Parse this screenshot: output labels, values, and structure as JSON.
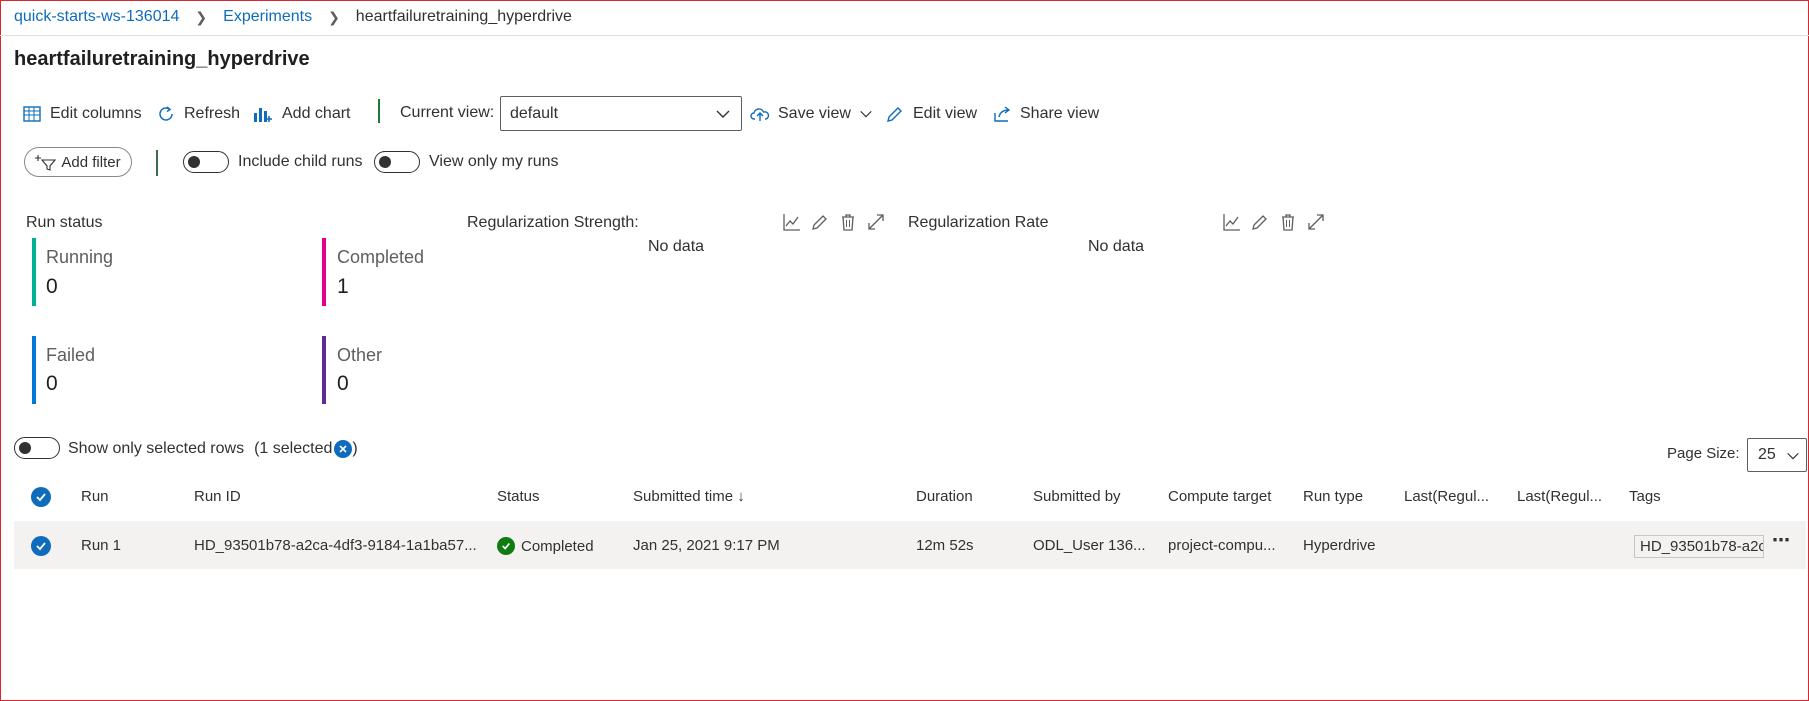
{
  "breadcrumb": {
    "workspace": "quick-starts-ws-136014",
    "experiments": "Experiments",
    "current": "heartfailuretraining_hyperdrive"
  },
  "page": {
    "title": "heartfailuretraining_hyperdrive"
  },
  "toolbar": {
    "edit_columns": "Edit columns",
    "refresh": "Refresh",
    "add_chart": "Add chart",
    "current_view_label": "Current view:",
    "current_view_value": "default",
    "save_view": "Save view",
    "edit_view": "Edit view",
    "share_view": "Share view"
  },
  "filters": {
    "add_filter": "Add filter",
    "include_child_runs": "Include child runs",
    "view_only_my_runs": "View only my runs"
  },
  "run_status": {
    "title": "Run status",
    "items": [
      {
        "label": "Running",
        "value": "0",
        "color": "#00b294"
      },
      {
        "label": "Completed",
        "value": "1",
        "color": "#e3008c"
      },
      {
        "label": "Failed",
        "value": "0",
        "color": "#0078d4"
      },
      {
        "label": "Other",
        "value": "0",
        "color": "#5c2e91"
      }
    ]
  },
  "charts": [
    {
      "title": "Regularization Strength:",
      "empty": "No data"
    },
    {
      "title": "Regularization Rate",
      "empty": "No data"
    }
  ],
  "selection": {
    "show_selected": "Show only selected rows",
    "selected_count": "(1 selected",
    "close_paren": ")"
  },
  "pagination": {
    "label": "Page Size:",
    "value": "25"
  },
  "table": {
    "headers": [
      "Run",
      "Run ID",
      "Status",
      "Submitted time ↓",
      "Duration",
      "Submitted by",
      "Compute target",
      "Run type",
      "Last(Regul...",
      "Last(Regul...",
      "Tags"
    ],
    "rows": [
      {
        "run": "Run 1",
        "run_id": "HD_93501b78-a2ca-4df3-9184-1a1ba57...",
        "status": "Completed",
        "submitted_time": "Jan 25, 2021 9:17 PM",
        "duration": "12m 52s",
        "submitted_by": "ODL_User 136...",
        "compute_target": "project-compu...",
        "run_type": "Hyperdrive",
        "tag": "HD_93501b78-a2c"
      }
    ]
  },
  "colors": {
    "accent": "#0f6cbd",
    "success": "#107c10"
  }
}
